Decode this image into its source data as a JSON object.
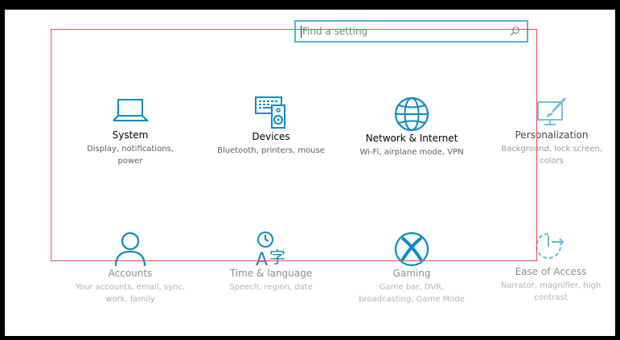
{
  "search": {
    "placeholder": "Find a setting",
    "value": ""
  },
  "tiles": [
    {
      "id": "system",
      "name": "System",
      "desc": "Display, notifications,\npower",
      "icon": "laptop-icon"
    },
    {
      "id": "devices",
      "name": "Devices",
      "desc": "Bluetooth, printers, mouse",
      "icon": "devices-icon"
    },
    {
      "id": "network",
      "name": "Network & Internet",
      "desc": "Wi-Fi, airplane mode, VPN",
      "icon": "globe-icon"
    },
    {
      "id": "personalization",
      "name": "Personalization",
      "desc": "Background, lock screen,\ncolors",
      "icon": "paint-icon"
    },
    {
      "id": "accounts",
      "name": "Accounts",
      "desc": "Your accounts, email, sync,\nwork, family",
      "icon": "person-icon"
    },
    {
      "id": "time-language",
      "name": "Time & language",
      "desc": "Speech, region, date",
      "icon": "time-language-icon"
    },
    {
      "id": "gaming",
      "name": "Gaming",
      "desc": "Game bar, DVR,\nbroadcasting, Game Mode",
      "icon": "xbox-icon"
    },
    {
      "id": "ease-of-access",
      "name": "Ease of Access",
      "desc": "Narrator, magnifier, high\ncontrast",
      "icon": "ease-of-access-icon"
    }
  ],
  "colors": {
    "accent": "#0a8bbf",
    "search_border": "#52b3d9",
    "overlay_border": "#ea4c59"
  }
}
